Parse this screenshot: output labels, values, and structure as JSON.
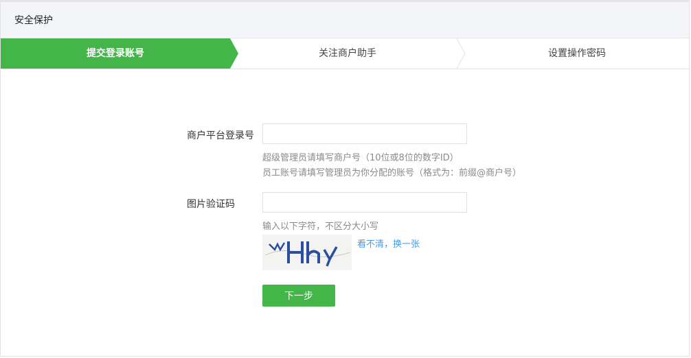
{
  "header": {
    "title": "安全保护"
  },
  "steps": [
    {
      "label": "提交登录账号",
      "state": "active"
    },
    {
      "label": "关注商户助手",
      "state": "pending"
    },
    {
      "label": "设置操作密码",
      "state": "pending"
    }
  ],
  "form": {
    "account": {
      "label": "商户平台登录号",
      "value": "",
      "hint1": "超级管理员请填写商户号（10位或8位的数字ID）",
      "hint2": "员工账号请填写管理员为你分配的账号（格式为：前缀@商户号）"
    },
    "captcha": {
      "label": "图片验证码",
      "value": "",
      "hint": "输入以下字符，不区分大小写",
      "refresh_label": "看不清，换一张"
    },
    "next_label": "下一步"
  },
  "colors": {
    "accent": "#44b549",
    "link": "#459ae9"
  }
}
